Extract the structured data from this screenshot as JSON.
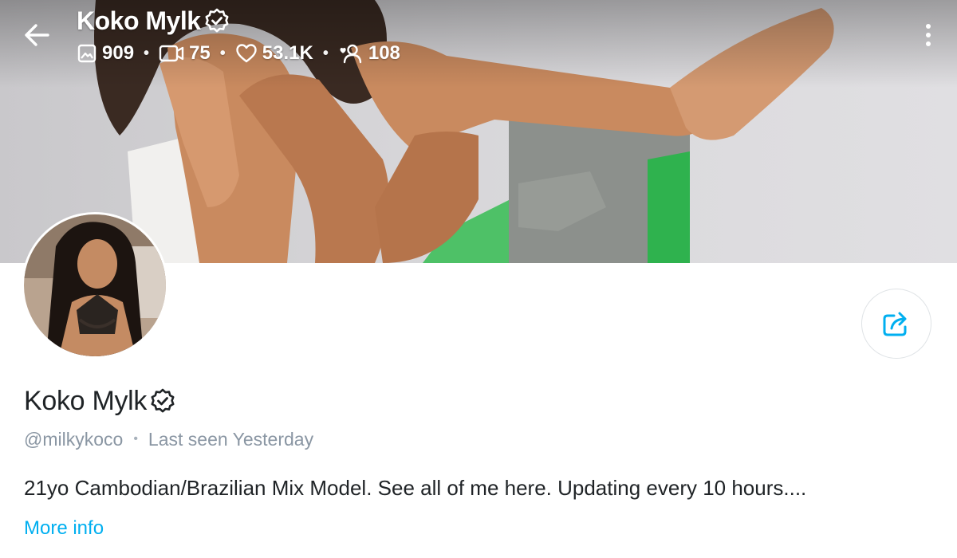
{
  "header": {
    "name": "Koko Mylk",
    "stats": {
      "photos": "909",
      "videos": "75",
      "likes": "53.1K",
      "fans": "108"
    }
  },
  "profile": {
    "name": "Koko Mylk",
    "handle": "@milkykoco",
    "last_seen": "Last seen Yesterday",
    "bio": "21yo Cambodian/Brazilian Mix Model. See all of me here. Updating every 10 hours....",
    "more_info_label": "More info"
  },
  "icons": {
    "back": "arrow-left-icon",
    "verified": "verified-badge-icon",
    "photos": "image-icon",
    "videos": "video-camera-icon",
    "likes": "heart-icon",
    "fans": "user-icon",
    "more": "more-vertical-icon",
    "share": "share-icon"
  },
  "colors": {
    "accent": "#00aff0",
    "muted_text": "#8a96a3",
    "primary_text": "#1f2326"
  }
}
